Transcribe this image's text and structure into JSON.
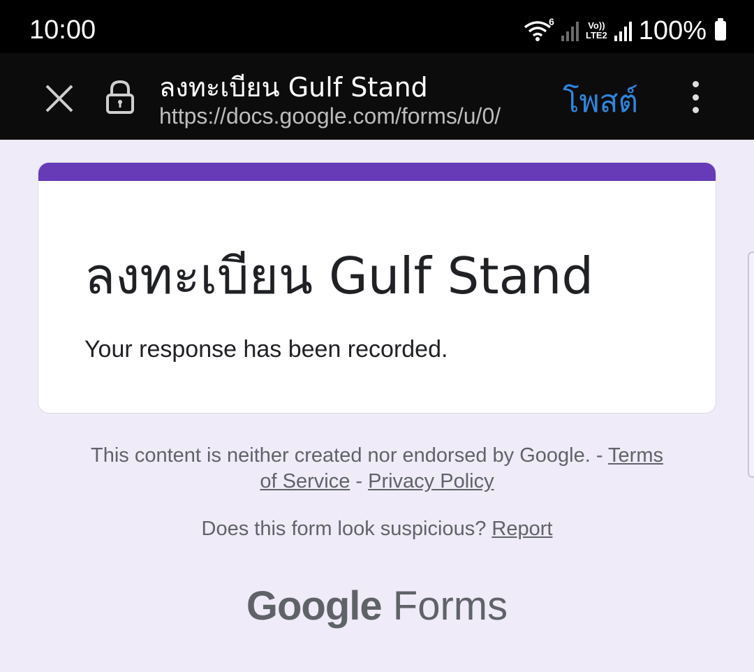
{
  "status_bar": {
    "time": "10:00",
    "wifi_generation": "6",
    "volte_label_top": "Vo))",
    "volte_label_bottom": "LTE2",
    "battery_percent": "100%"
  },
  "toolbar": {
    "title": "ลงทะเบียน Gulf Stand",
    "url": "https://docs.google.com/forms/u/0/",
    "post_label": "โพสต์",
    "post_color": "#2e86de"
  },
  "form": {
    "accent_color": "#673ab7",
    "title": "ลงทะเบียน Gulf Stand",
    "confirmation": "Your response has been recorded."
  },
  "footer": {
    "disclaimer": "This content is neither created nor endorsed by Google. - ",
    "terms_part1": "Terms",
    "terms_part2": "of Service",
    "separator": " - ",
    "privacy": "Privacy Policy",
    "suspicious": "Does this form look suspicious? ",
    "report": "Report"
  },
  "logo": {
    "brand": "Google",
    "product": "Forms"
  }
}
